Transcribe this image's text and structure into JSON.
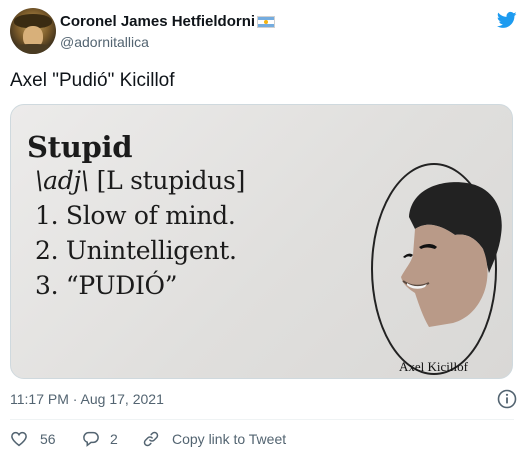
{
  "tweet": {
    "author": {
      "display_name": "Coronel James Hetfieldorni",
      "handle": "@adornitallica",
      "flag_icon": "argentina-flag-icon",
      "avatar_icon": "avatar"
    },
    "text": "Axel \"Pudió\" Kicillof",
    "timestamp": "11:17 PM · Aug 17, 2021"
  },
  "media": {
    "word": "Stupid",
    "pronunciation": "\\adj\\",
    "etymology": " [L stupidus]",
    "definitions": [
      "1. Slow of mind.",
      "2. Unintelligent.",
      "3. “PUDIÓ”"
    ],
    "caption": "Axel Kicillof"
  },
  "actions": {
    "like_count": "56",
    "reply_count": "2",
    "copy_link_label": "Copy link to Tweet"
  },
  "colors": {
    "text_primary": "#0f1419",
    "text_secondary": "#536471",
    "twitter_blue": "#1d9bf0",
    "divider": "#eff3f4"
  }
}
